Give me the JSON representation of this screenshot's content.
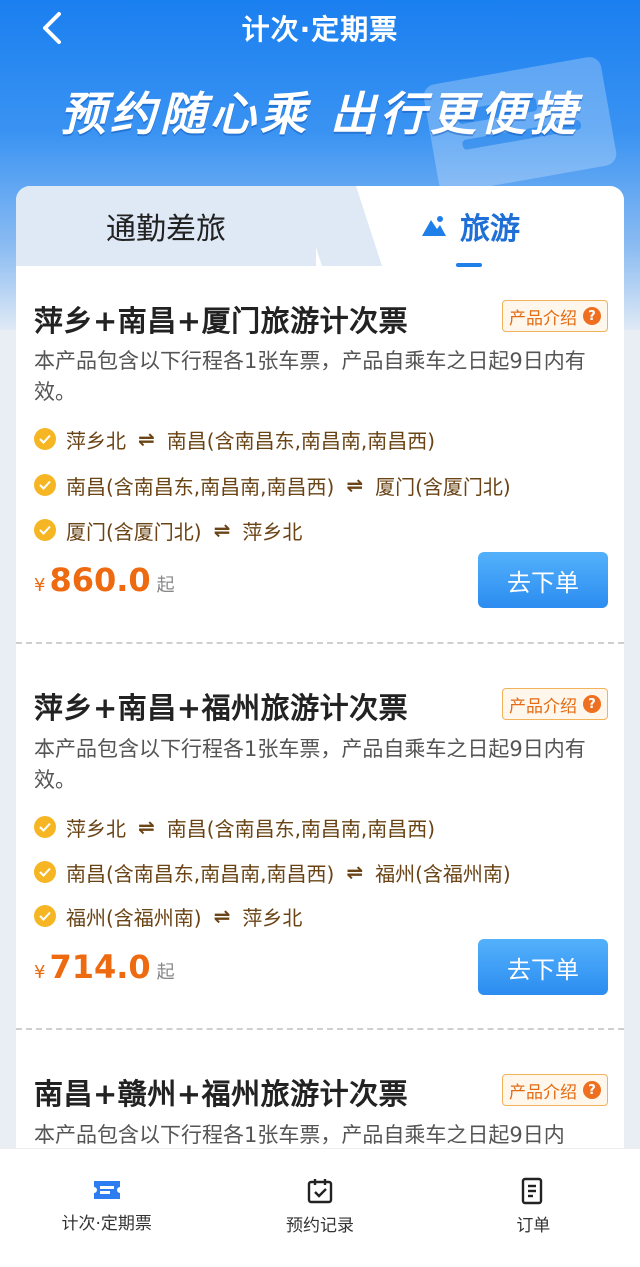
{
  "header": {
    "title": "计次·定期票",
    "slogan": "预约随心乘 出行更便捷"
  },
  "tabs": [
    {
      "label": "通勤差旅",
      "active": false
    },
    {
      "label": "旅游",
      "active": true
    }
  ],
  "products": [
    {
      "title": "萍乡+南昌+厦门旅游计次票",
      "intro_label": "产品介绍",
      "desc": "本产品包含以下行程各1张车票，产品自乘车之日起9日内有效。",
      "routes": [
        {
          "from": "萍乡北",
          "to": "南昌(含南昌东,南昌南,南昌西)"
        },
        {
          "from": "南昌(含南昌东,南昌南,南昌西)",
          "to": "厦门(含厦门北)"
        },
        {
          "from": "厦门(含厦门北)",
          "to": "萍乡北"
        }
      ],
      "currency": "¥",
      "price": "860.0",
      "price_suffix": "起",
      "order_label": "去下单"
    },
    {
      "title": "萍乡+南昌+福州旅游计次票",
      "intro_label": "产品介绍",
      "desc": "本产品包含以下行程各1张车票，产品自乘车之日起9日内有效。",
      "routes": [
        {
          "from": "萍乡北",
          "to": "南昌(含南昌东,南昌南,南昌西)"
        },
        {
          "from": "南昌(含南昌东,南昌南,南昌西)",
          "to": "福州(含福州南)"
        },
        {
          "from": "福州(含福州南)",
          "to": "萍乡北"
        }
      ],
      "currency": "¥",
      "price": "714.0",
      "price_suffix": "起",
      "order_label": "去下单"
    },
    {
      "title": "南昌+赣州+福州旅游计次票",
      "intro_label": "产品介绍",
      "desc": "本产品包含以下行程各1张车票，产品自乘车之日起9日内"
    }
  ],
  "bottom_nav": [
    {
      "label": "计次·定期票",
      "icon": "ticket-icon",
      "active": true
    },
    {
      "label": "预约记录",
      "icon": "calendar-check-icon",
      "active": false
    },
    {
      "label": "订单",
      "icon": "order-list-icon",
      "active": false
    }
  ],
  "colors": {
    "primary": "#1f7fe8",
    "price": "#ee6a10",
    "route_text": "#6b4416",
    "check": "#f6b623"
  }
}
